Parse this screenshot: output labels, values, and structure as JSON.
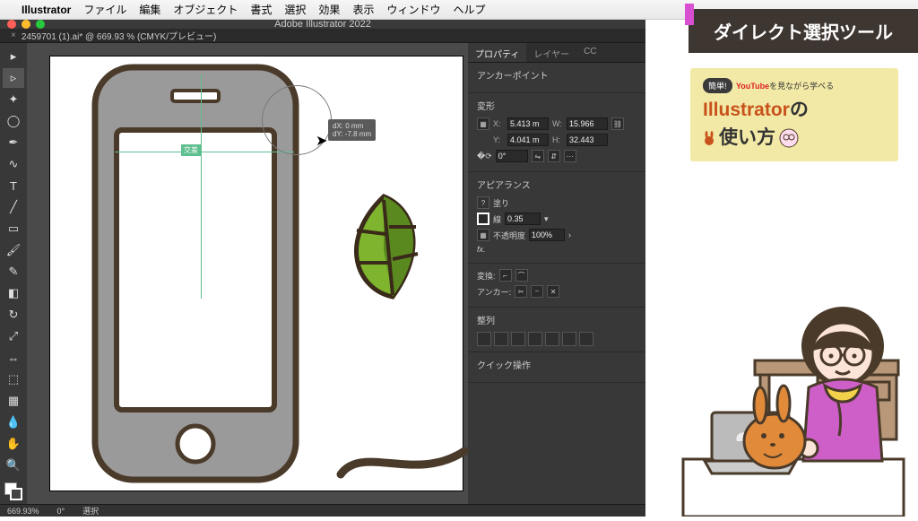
{
  "menubar": {
    "app": "Illustrator",
    "items": [
      "ファイル",
      "編集",
      "オブジェクト",
      "書式",
      "選択",
      "効果",
      "表示",
      "ウィンドウ",
      "ヘルプ"
    ]
  },
  "window": {
    "title": "Adobe Illustrator 2022",
    "doc_tab": "2459701 (1).ai* @ 669.93 % (CMYK/プレビュー)"
  },
  "tools": [
    "selection",
    "direct-select",
    "wand",
    "lasso",
    "pen",
    "curvature",
    "type",
    "line",
    "rect",
    "brush",
    "shaper",
    "eraser",
    "rotate",
    "scale",
    "width",
    "free",
    "shape-builder",
    "perspective",
    "mesh",
    "gradient",
    "eyedropper",
    "blend",
    "symbol",
    "column",
    "artboard",
    "slice",
    "hand",
    "zoom"
  ],
  "props": {
    "tabs": [
      "プロパティ",
      "レイヤー",
      "CC"
    ],
    "anchor_label": "アンカーポイント",
    "transform_label": "変形",
    "x_label": "X:",
    "x_val": "5.413 m",
    "y_label": "Y:",
    "y_val": "4.041 m",
    "w_label": "W:",
    "w_val": "15.966",
    "h_label": "H:",
    "h_val": "32.443",
    "rotate_val": "0°",
    "appearance_label": "アピアランス",
    "fill_label": "塗り",
    "stroke_label": "線",
    "stroke_val": "0.35",
    "opacity_label": "不透明度",
    "opacity_val": "100%",
    "convert_label": "変換:",
    "anchor_tools_label": "アンカー:",
    "align_label": "整列",
    "quick_label": "クイック操作"
  },
  "status": {
    "zoom": "669.93%",
    "rotate": "0°",
    "mode": "選択"
  },
  "overlay": {
    "title": "ダイレクト選択ツール"
  },
  "promo": {
    "badge": "簡単!",
    "sub1": "YouTube",
    "sub2": "を見ながら学べる",
    "brand": "Illustrator",
    "suffix": "の",
    "line2": "使い方"
  },
  "hint": {
    "dx": "dX: 0 mm",
    "dy": "dY: -7.8 mm"
  },
  "guide_label": "交差",
  "colors": {
    "phone_body": "#9a9a9a",
    "phone_stroke": "#4a3a2a",
    "leaf_fill": "#7fb52e",
    "leaf_dark": "#5a8a1f"
  }
}
